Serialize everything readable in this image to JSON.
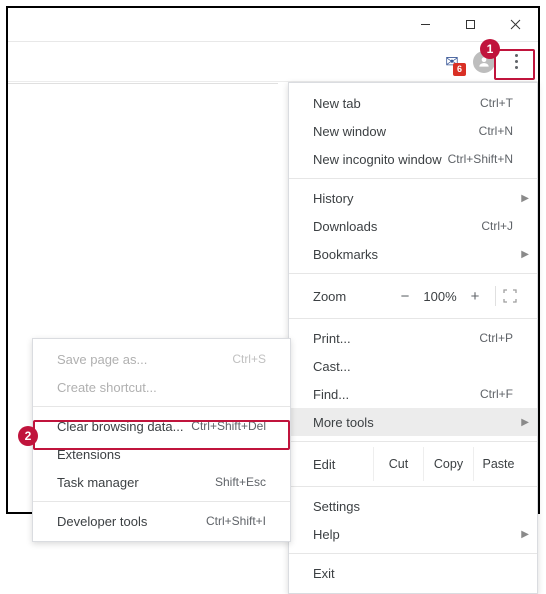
{
  "window": {
    "mail_badge": "6"
  },
  "callouts": {
    "one": "1",
    "two": "2"
  },
  "menu": {
    "new_tab": {
      "label": "New tab",
      "shortcut": "Ctrl+T"
    },
    "new_window": {
      "label": "New window",
      "shortcut": "Ctrl+N"
    },
    "new_incognito": {
      "label": "New incognito window",
      "shortcut": "Ctrl+Shift+N"
    },
    "history": {
      "label": "History"
    },
    "downloads": {
      "label": "Downloads",
      "shortcut": "Ctrl+J"
    },
    "bookmarks": {
      "label": "Bookmarks"
    },
    "zoom": {
      "label": "Zoom",
      "minus": "−",
      "value": "100%",
      "plus": "+"
    },
    "print": {
      "label": "Print...",
      "shortcut": "Ctrl+P"
    },
    "cast": {
      "label": "Cast..."
    },
    "find": {
      "label": "Find...",
      "shortcut": "Ctrl+F"
    },
    "more_tools": {
      "label": "More tools"
    },
    "edit": {
      "label": "Edit",
      "cut": "Cut",
      "copy": "Copy",
      "paste": "Paste"
    },
    "settings": {
      "label": "Settings"
    },
    "help": {
      "label": "Help"
    },
    "exit": {
      "label": "Exit"
    }
  },
  "submenu": {
    "save_page": {
      "label": "Save page as...",
      "shortcut": "Ctrl+S"
    },
    "create_shortcut": {
      "label": "Create shortcut..."
    },
    "clear_data": {
      "label": "Clear browsing data...",
      "shortcut": "Ctrl+Shift+Del"
    },
    "extensions": {
      "label": "Extensions"
    },
    "task_manager": {
      "label": "Task manager",
      "shortcut": "Shift+Esc"
    },
    "dev_tools": {
      "label": "Developer tools",
      "shortcut": "Ctrl+Shift+I"
    }
  }
}
